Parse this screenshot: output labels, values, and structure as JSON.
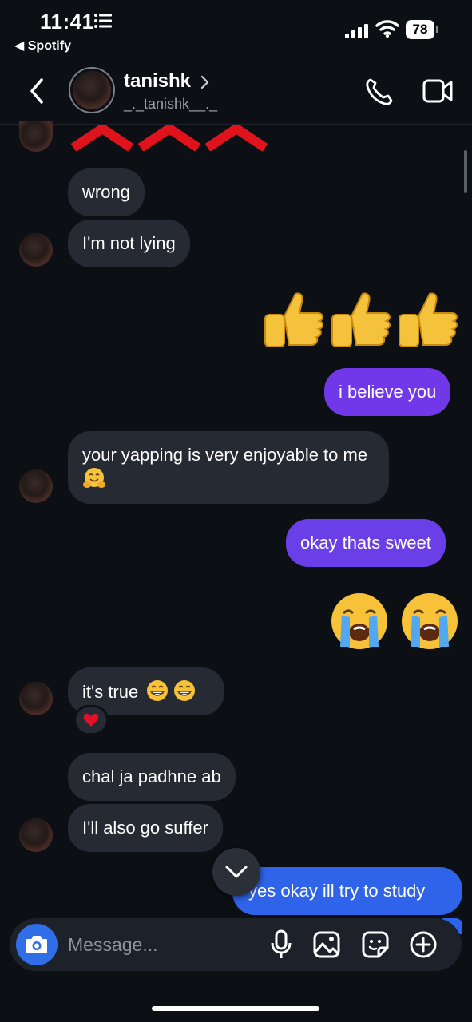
{
  "status_bar": {
    "time": "11:41",
    "back_app": "◀ Spotify",
    "battery": "78"
  },
  "header": {
    "username": "tanishk",
    "handle": "_._tanishk__._"
  },
  "messages": {
    "m1": "wrong",
    "m2": "I'm not lying",
    "m3": "i believe you",
    "m4": "your yapping is very enjoyable to me",
    "m5": "okay thats sweet",
    "m6": "it's true",
    "m7": "chal ja padhne ab",
    "m8": "I'll also go suffer",
    "m9": "yes okay ill try to study"
  },
  "composer": {
    "placeholder": "Message..."
  },
  "colors": {
    "background": "#0c0f14",
    "incoming_bubble": "#262a33",
    "outgoing_purple": "#7038e8",
    "outgoing_blue": "#2f63ea",
    "camera_button": "#2f6ee6"
  },
  "icons": [
    "back-chevron-icon",
    "chevron-right-icon",
    "phone-icon",
    "video-camera-icon",
    "thumbs-up-emoji",
    "crying-face-emoji",
    "grinning-face-emoji",
    "hug-emoji",
    "heart-reaction-icon",
    "chevron-down-icon",
    "camera-icon",
    "microphone-icon",
    "image-icon",
    "sticker-icon",
    "plus-circle-icon"
  ]
}
